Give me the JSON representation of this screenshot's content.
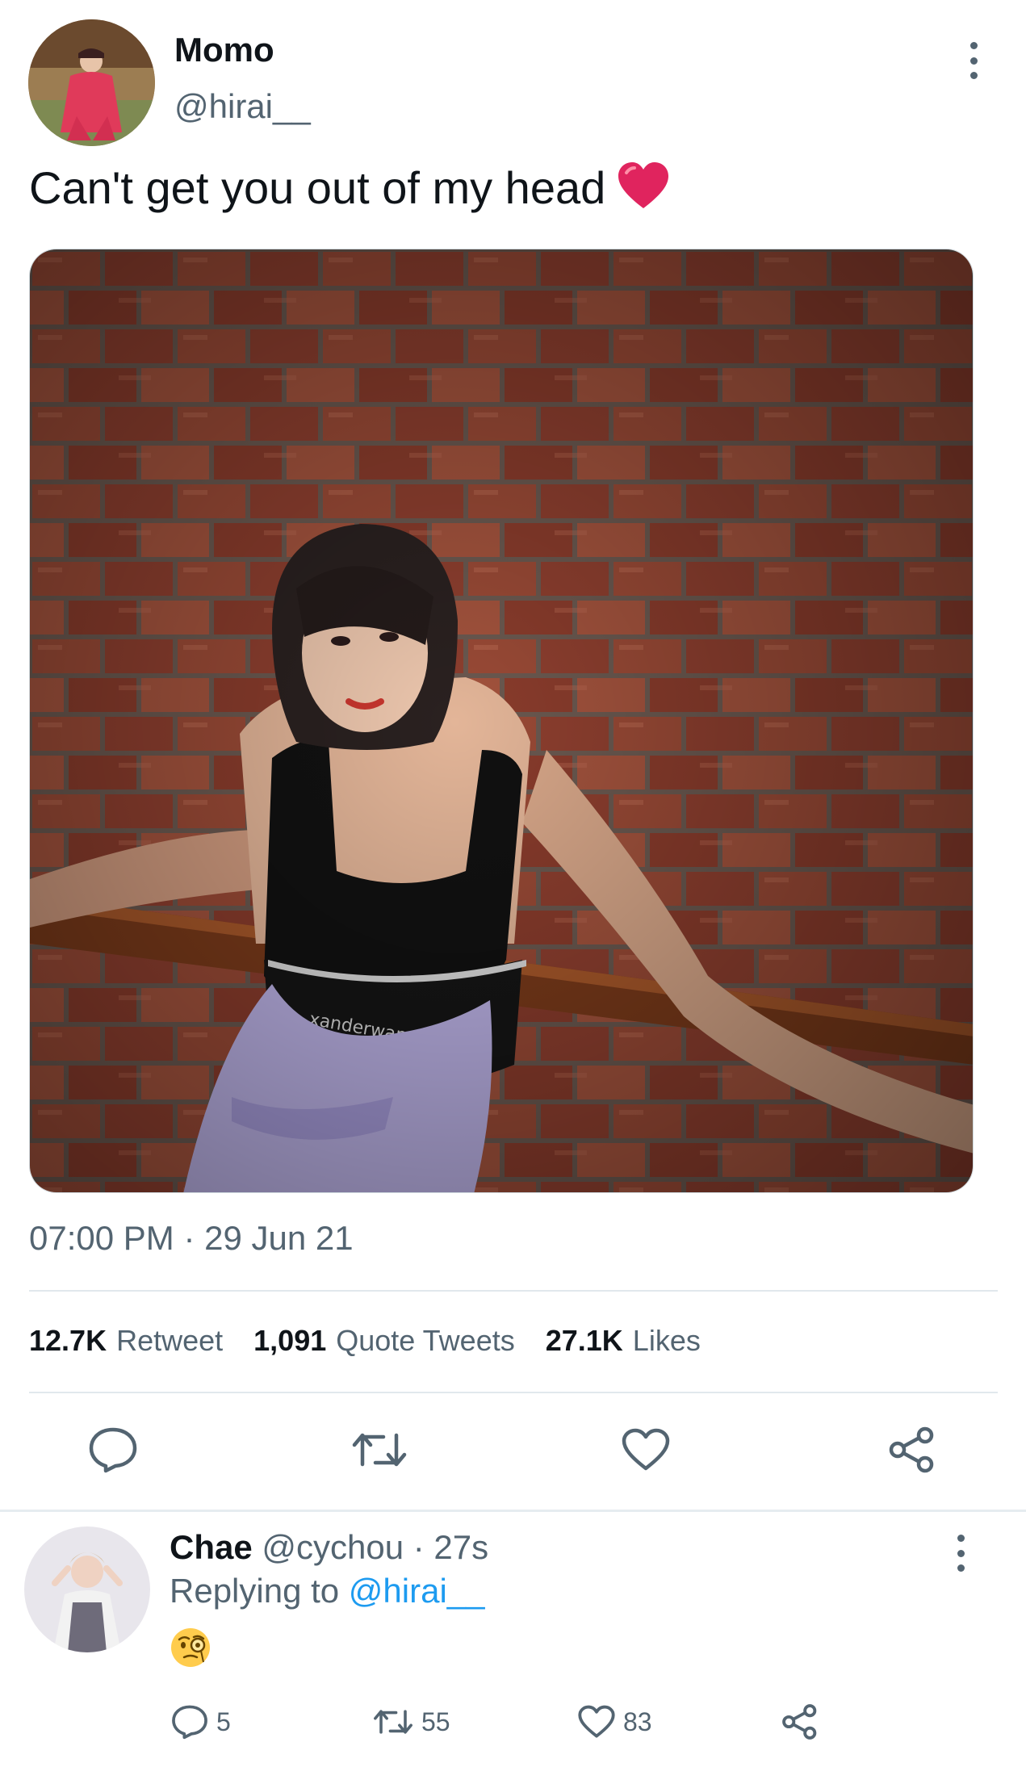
{
  "tweet": {
    "author_name": "Momo",
    "author_handle": "@hirai__",
    "text": "Can't get you out of my head",
    "text_emoji": "heart-emoji",
    "timestamp": "07:00 PM · 29 Jun 21",
    "photo_print_text": "xanderwang",
    "stats": [
      {
        "value": "12.7K",
        "label": "Retweet"
      },
      {
        "value": "1,091",
        "label": "Quote Tweets"
      },
      {
        "value": "27.1K",
        "label": "Likes"
      }
    ],
    "actions": [
      "reply-icon",
      "retweet-icon",
      "like-icon",
      "share-icon"
    ]
  },
  "reply": {
    "author_name": "Chae",
    "author_handle": "@cychou",
    "time": "· 27s",
    "replying_prefix": "Replying to",
    "replying_to": "@hirai__",
    "emoji": "face-with-monocle-emoji",
    "counts": {
      "replies": "5",
      "retweets": "55",
      "likes": "83"
    }
  },
  "colors": {
    "primary_text": "#0f1419",
    "secondary_text": "#536471",
    "link": "#1d9bf0",
    "heart": "#e0245e",
    "divider": "#e1e8ed"
  }
}
